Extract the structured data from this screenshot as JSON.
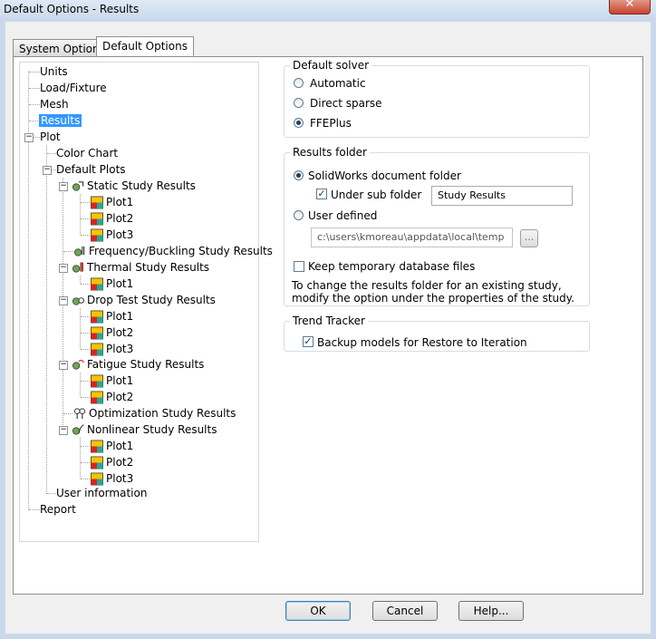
{
  "window": {
    "title": "Default Options - Results",
    "close_glyph": "✕"
  },
  "tabs": [
    {
      "label": "System Options"
    },
    {
      "label": "Default Options"
    }
  ],
  "tree": {
    "units": "Units",
    "load_fixture": "Load/Fixture",
    "mesh": "Mesh",
    "results": "Results",
    "plot": "Plot",
    "color_chart": "Color Chart",
    "default_plots": "Default Plots",
    "static": "Static Study Results",
    "static_plots": [
      "Plot1",
      "Plot2",
      "Plot3"
    ],
    "frequency": "Frequency/Buckling Study Results",
    "thermal": "Thermal Study Results",
    "thermal_plots": [
      "Plot1"
    ],
    "drop": "Drop Test Study Results",
    "drop_plots": [
      "Plot1",
      "Plot2",
      "Plot3"
    ],
    "fatigue": "Fatigue Study Results",
    "fatigue_plots": [
      "Plot1",
      "Plot2"
    ],
    "optimization": "Optimization Study Results",
    "nonlinear": "Nonlinear Study Results",
    "nonlinear_plots": [
      "Plot1",
      "Plot2",
      "Plot3"
    ],
    "user_information": "User information",
    "report": "Report"
  },
  "default_solver": {
    "legend": "Default solver",
    "options": [
      "Automatic",
      "Direct sparse",
      "FFEPlus"
    ],
    "selected": "FFEPlus"
  },
  "results_folder": {
    "legend": "Results folder",
    "solidworks_folder": "SolidWorks document folder",
    "under_sub_folder": "Under sub folder",
    "sub_folder_value": "Study Results",
    "user_defined": "User defined",
    "path_value": "c:\\users\\kmoreau\\appdata\\local\\temp",
    "browse": "...",
    "keep_temp": "Keep temporary database files",
    "note": "To change the results folder for an existing study, modify the option under the properties of the study."
  },
  "trend_tracker": {
    "legend": "Trend Tracker",
    "backup": "Backup models for Restore to Iteration"
  },
  "buttons": {
    "ok": "OK",
    "cancel": "Cancel",
    "help": "Help..."
  },
  "colors": {
    "selection": "#3399ff",
    "frame": "#c9d9ec",
    "close": "#c7432c"
  }
}
